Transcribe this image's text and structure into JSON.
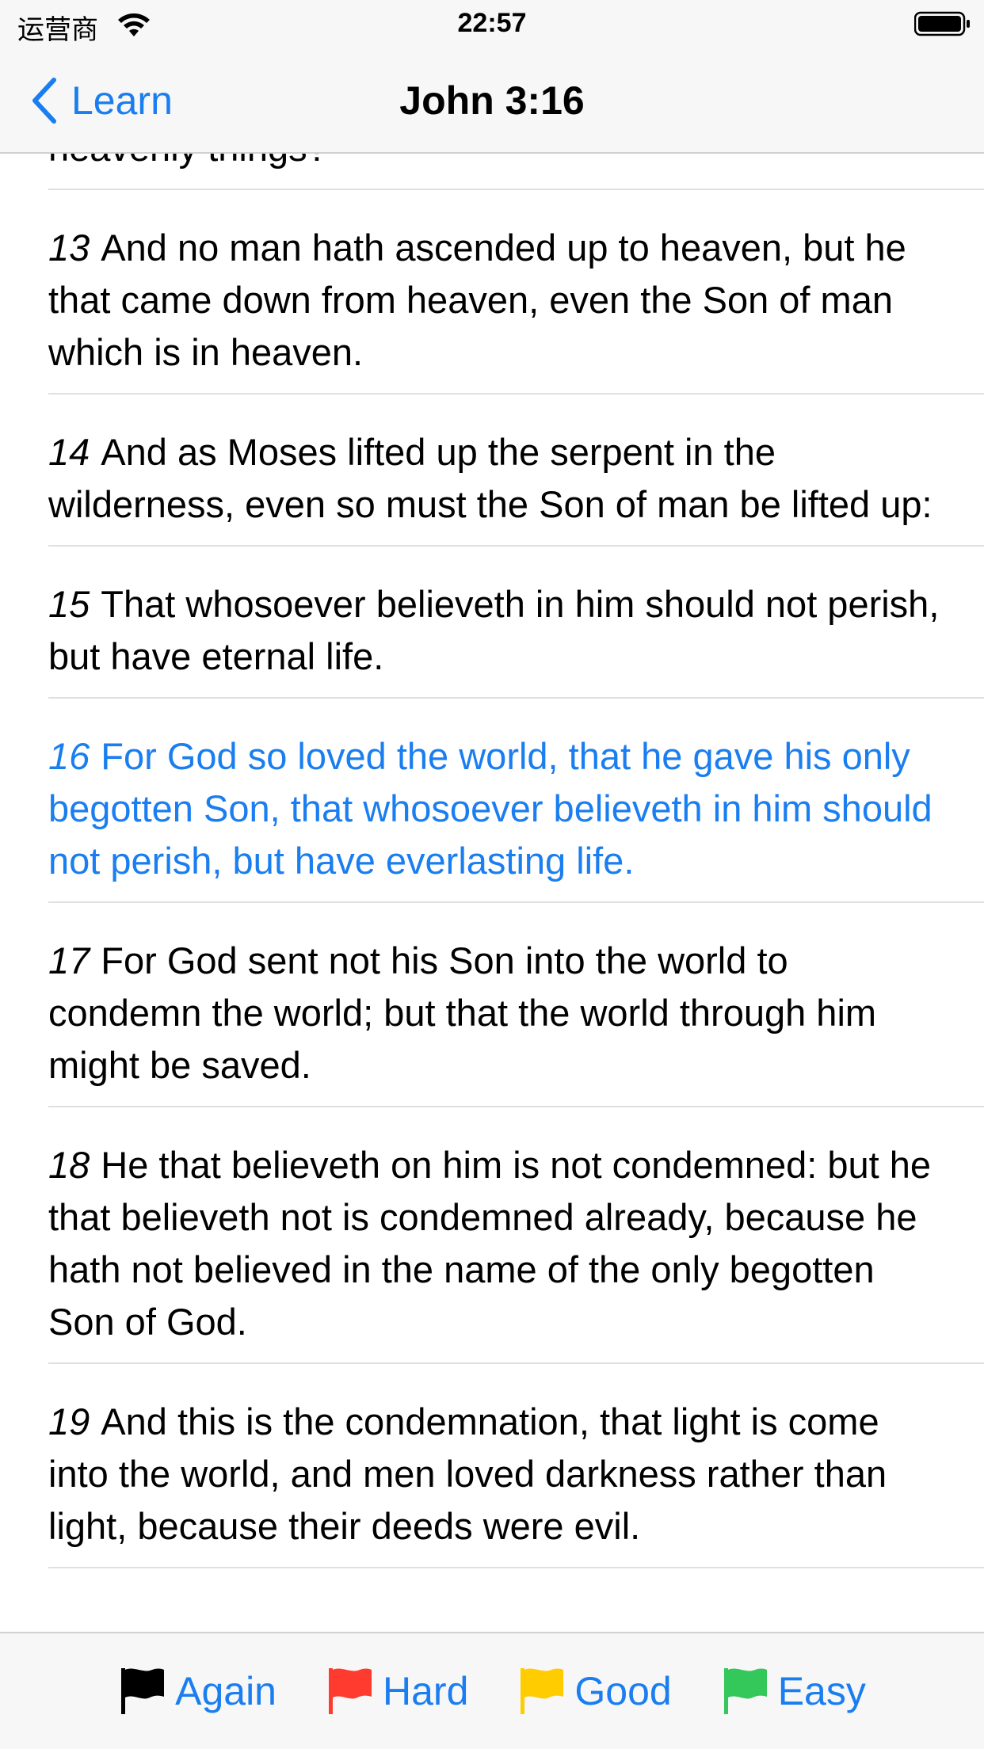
{
  "status_bar": {
    "carrier": "运营商",
    "time": "22:57"
  },
  "nav": {
    "back_label": "Learn",
    "title": "John 3:16"
  },
  "verses": [
    {
      "num": "",
      "text": "heavenly things?"
    },
    {
      "num": "13",
      "text": "And no man hath ascended up to heaven, but he that came down from heaven, even the Son of man which is in heaven."
    },
    {
      "num": "14",
      "text": "And as Moses lifted up the serpent in the wilderness, even so must the Son of man be lifted up:"
    },
    {
      "num": "15",
      "text": "That whosoever believeth in him should not perish, but have eternal life."
    },
    {
      "num": "16",
      "text": "For God so loved the world, that he gave his only begotten Son, that whosoever believeth in him should not perish, but have everlasting life."
    },
    {
      "num": "17",
      "text": "For God sent not his Son into the world to condemn the world; but that the world through him might be saved."
    },
    {
      "num": "18",
      "text": "He that believeth on him is not condemned: but he that believeth not is condemned already, because he hath not believed in the name of the only begotten Son of God."
    },
    {
      "num": "19",
      "text": "And this is the condemnation, that light is come into the world, and men loved darkness rather than light, because their deeds were evil."
    }
  ],
  "active_verse": "16",
  "rating_buttons": [
    {
      "label": "Again",
      "flag_color": "#000000"
    },
    {
      "label": "Hard",
      "flag_color": "#ff3b30"
    },
    {
      "label": "Good",
      "flag_color": "#ffcc00"
    },
    {
      "label": "Easy",
      "flag_color": "#34c759"
    }
  ],
  "colors": {
    "accent": "#1a7ef0"
  }
}
